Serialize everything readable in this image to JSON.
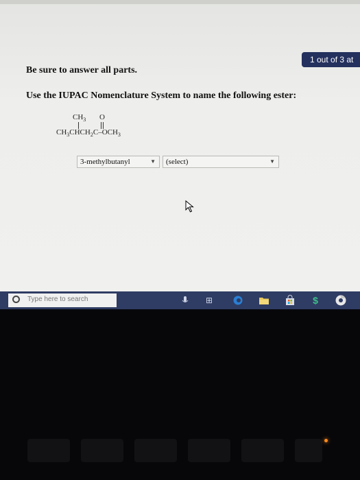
{
  "header": {
    "progress": "1 out of 3 at"
  },
  "instructions": {
    "line1": "Be sure to answer all parts.",
    "line2": "Use the IUPAC Nomenclature System to name the following ester:"
  },
  "structure": {
    "top_ch3": "CH",
    "top_ch3_sub": "3",
    "top_o": "O",
    "chain": [
      {
        "t": "CH"
      },
      {
        "t": "3",
        "sub": true
      },
      {
        "t": "CHCH"
      },
      {
        "t": "2",
        "sub": true
      },
      {
        "t": "C"
      },
      {
        "t": "–"
      },
      {
        "t": "OCH"
      },
      {
        "t": "3",
        "sub": true
      }
    ]
  },
  "answer": {
    "select1": "3-methylbutanyl",
    "select2": "(select)"
  },
  "taskbar": {
    "search_placeholder": "Type here to search",
    "cortana_glyph": "⎚",
    "taskview_glyph": "⊞",
    "store_glyph": "🛍",
    "dollar_glyph": "$"
  },
  "colors": {
    "taskbar": "#2f3c63",
    "badge": "#24305e"
  }
}
